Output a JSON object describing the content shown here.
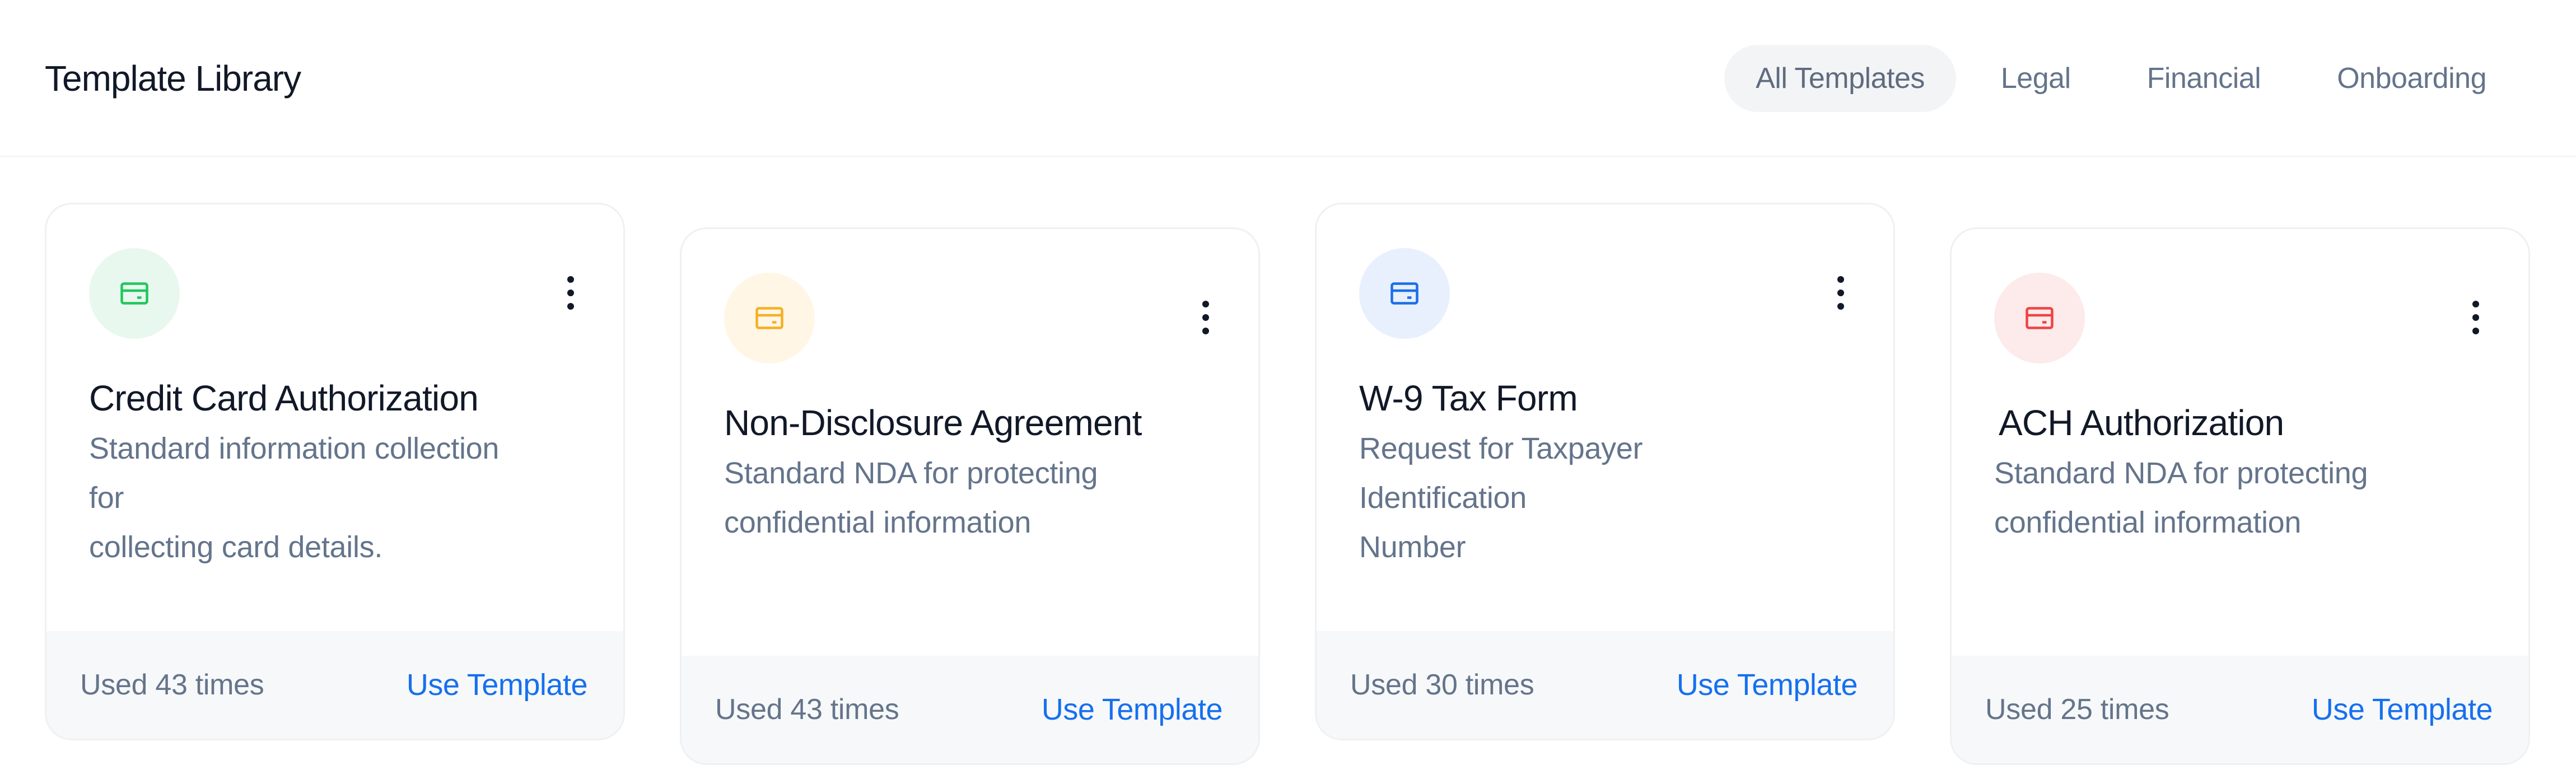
{
  "header": {
    "title": "Template Library",
    "filters": [
      {
        "label": "All Templates",
        "active": true
      },
      {
        "label": "Legal",
        "active": false
      },
      {
        "label": "Financial",
        "active": false
      },
      {
        "label": "Onboarding",
        "active": false
      }
    ]
  },
  "cards": [
    {
      "icon": "card-icon",
      "icon_color": "#22c55e",
      "icon_bg": "#e8f8ee",
      "title": "Credit Card Authorization",
      "description": "Standard information collection\nfor\ncollecting card details.",
      "usage": "Used 43 times",
      "action": "Use Template"
    },
    {
      "icon": "card-icon",
      "icon_color": "#f5b022",
      "icon_bg": "#fff6e6",
      "title": "Non-Disclosure Agreement",
      "description": "Standard NDA for protecting\nconfidential information",
      "usage": "Used 43 times",
      "action": "Use Template"
    },
    {
      "icon": "card-icon",
      "icon_color": "#1a6fe8",
      "icon_bg": "#e8f0fd",
      "title": "W-9 Tax Form",
      "description": "Request for Taxpayer\nIdentification\nNumber",
      "usage": "Used 30 times",
      "action": "Use Template"
    },
    {
      "icon": "card-icon",
      "icon_color": "#ef4444",
      "icon_bg": "#fdeaea",
      "title": "ACH Authorization",
      "description": "Standard NDA for protecting\nconfidential information",
      "usage": "Used 25 times",
      "action": "Use Template"
    }
  ]
}
